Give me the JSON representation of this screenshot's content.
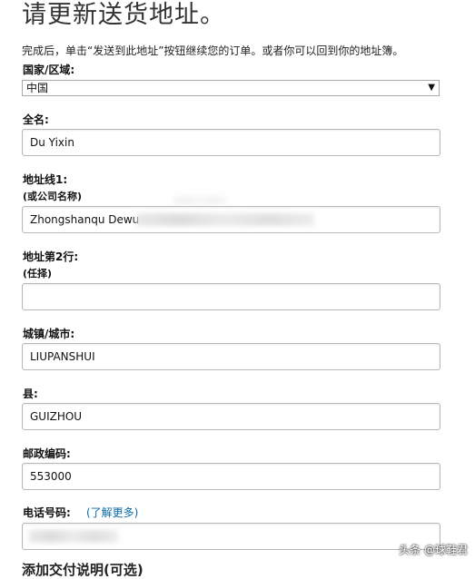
{
  "page": {
    "title": "请更新送货地址。",
    "description": "完成后，单击“发送到此地址”按钮继续您的订单。或者你可以回到你的地址簿。"
  },
  "country": {
    "label": "国家/区域:",
    "value": "中国"
  },
  "fullname": {
    "label": "全名:",
    "value": "Du Yixin"
  },
  "address1": {
    "label": "地址线1:",
    "hint": "(或公司名称)",
    "value": "Zhongshanqu Dewu"
  },
  "address2": {
    "label": "地址第2行:",
    "hint": "(任择)",
    "value": ""
  },
  "city": {
    "label": "城镇/城市:",
    "value": "LIUPANSHUI"
  },
  "county": {
    "label": "县:",
    "value": "GUIZHOU"
  },
  "postcode": {
    "label": "邮政编码:",
    "value": "553000"
  },
  "phone": {
    "label": "电话号码:",
    "learn_more": "(了解更多)",
    "value": ""
  },
  "next_section": {
    "label": "添加交付说明(可选)"
  },
  "watermark": "头条 @球鞋君"
}
